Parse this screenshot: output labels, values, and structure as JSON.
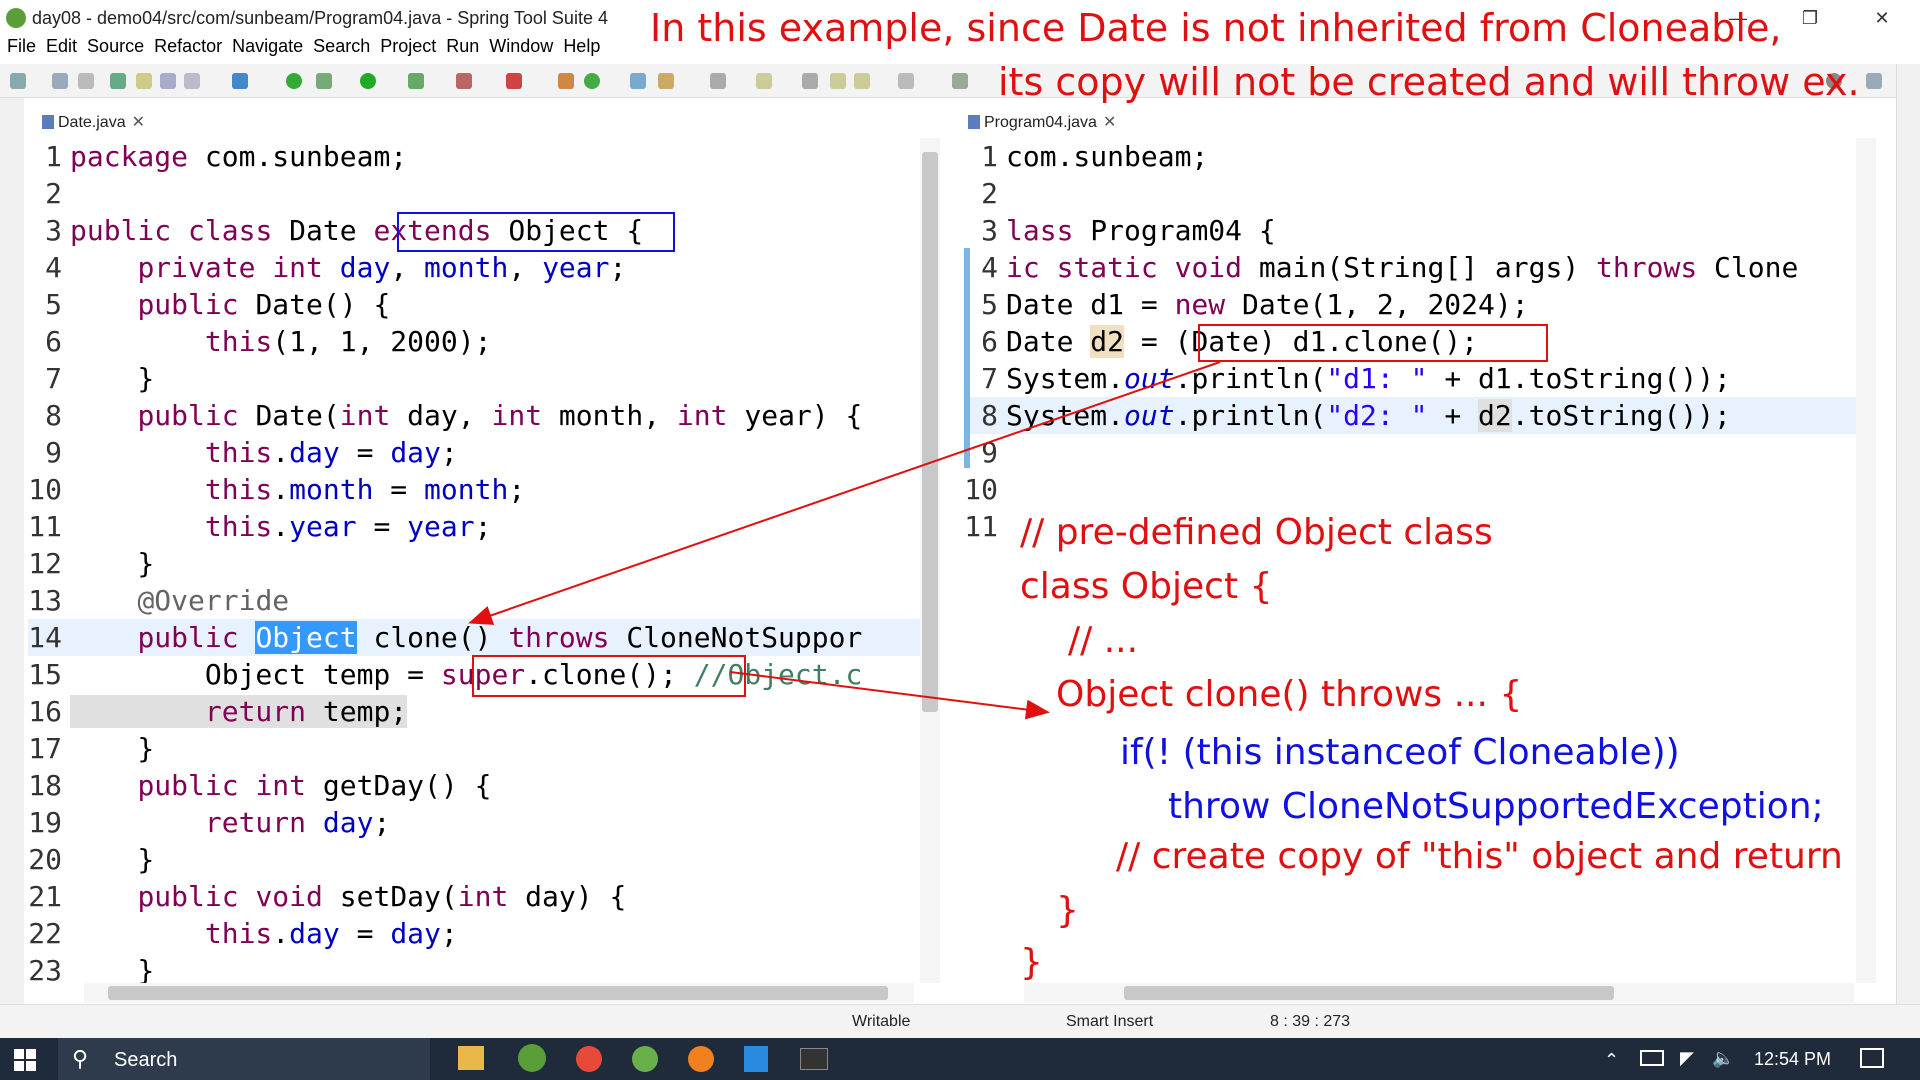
{
  "window": {
    "title": "day08 - demo04/src/com/sunbeam/Program04.java - Spring Tool Suite 4",
    "minimize_icon": "minimize-icon",
    "restore_icon": "restore-icon",
    "close_icon": "close-icon"
  },
  "menu": [
    "File",
    "Edit",
    "Source",
    "Refactor",
    "Navigate",
    "Search",
    "Project",
    "Run",
    "Window",
    "Help"
  ],
  "tabs": {
    "left": "Date.java",
    "right": "Program04.java"
  },
  "left_code": [
    {
      "n": "1",
      "t": "package com.sunbeam;"
    },
    {
      "n": "2",
      "t": ""
    },
    {
      "n": "3",
      "t": "public class Date extends Object {"
    },
    {
      "n": "4",
      "t": "    private int day, month, year;"
    },
    {
      "n": "5",
      "t": "    public Date() {"
    },
    {
      "n": "6",
      "t": "        this(1, 1, 2000);"
    },
    {
      "n": "7",
      "t": "    }"
    },
    {
      "n": "8",
      "t": "    public Date(int day, int month, int year) {"
    },
    {
      "n": "9",
      "t": "        this.day = day;"
    },
    {
      "n": "10",
      "t": "        this.month = month;"
    },
    {
      "n": "11",
      "t": "        this.year = year;"
    },
    {
      "n": "12",
      "t": "    }"
    },
    {
      "n": "13",
      "t": "    @Override"
    },
    {
      "n": "14",
      "t": "    public Object clone() throws CloneNotSuppor"
    },
    {
      "n": "15",
      "t": "        Object temp = super.clone(); //Object.c"
    },
    {
      "n": "16",
      "t": "        return temp;"
    },
    {
      "n": "17",
      "t": "    }"
    },
    {
      "n": "18",
      "t": "    public int getDay() {"
    },
    {
      "n": "19",
      "t": "        return day;"
    },
    {
      "n": "20",
      "t": "    }"
    },
    {
      "n": "21",
      "t": "    public void setDay(int day) {"
    },
    {
      "n": "22",
      "t": "        this.day = day;"
    },
    {
      "n": "23",
      "t": "    }"
    }
  ],
  "right_code": [
    {
      "n": "1",
      "t": "com.sunbeam;"
    },
    {
      "n": "2",
      "t": ""
    },
    {
      "n": "3",
      "t": "lass Program04 {"
    },
    {
      "n": "4",
      "t": "ic static void main(String[] args) throws Clone"
    },
    {
      "n": "5",
      "t": "Date d1 = new Date(1, 2, 2024);"
    },
    {
      "n": "6",
      "t": "Date d2 = (Date) d1.clone();"
    },
    {
      "n": "7",
      "t": "System.out.println(\"d1: \" + d1.toString());"
    },
    {
      "n": "8",
      "t": "System.out.println(\"d2: \" + d2.toString());"
    },
    {
      "n": "9",
      "t": ""
    },
    {
      "n": "10",
      "t": ""
    },
    {
      "n": "11",
      "t": ""
    }
  ],
  "annotations": {
    "headline_1": "In this example, since Date is not inherited from Cloneable,",
    "headline_2": "its copy will not be created and will throw ex.",
    "note_1": "// pre-defined Object class",
    "note_2": "class Object {",
    "note_3": "// ...",
    "note_4": "Object clone() throws ... {",
    "note_5": "if(! (this instanceof Cloneable))",
    "note_6": "throw CloneNotSupportedException;",
    "note_7": "// create copy of \"this\" object and return",
    "note_8": "}",
    "note_9": "}"
  },
  "status": {
    "writable": "Writable",
    "insert_mode": "Smart Insert",
    "position": "8 : 39 : 273"
  },
  "taskbar": {
    "search_label": "Search",
    "time": "12:54 PM"
  },
  "colors": {
    "annotation_red": "#e01010",
    "annotation_blue": "#1010e0",
    "keyword": "#7f0055",
    "field": "#0000c0",
    "string": "#2a00ff"
  }
}
